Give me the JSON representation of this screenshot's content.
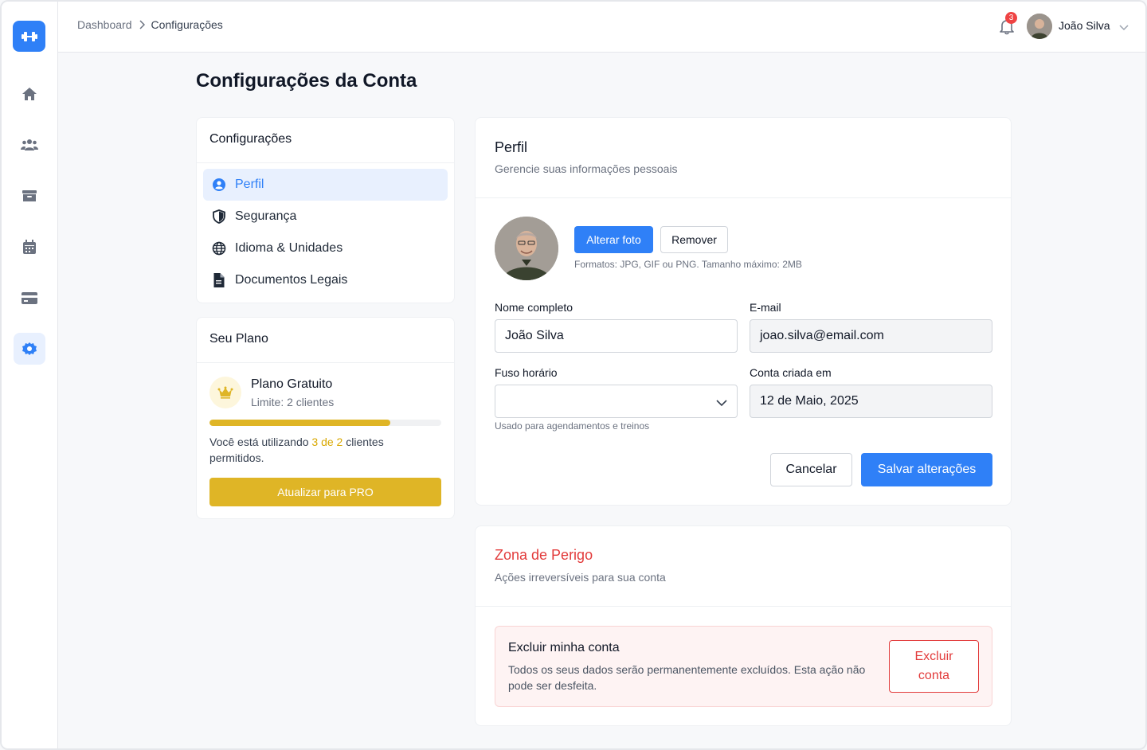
{
  "breadcrumb": {
    "root": "Dashboard",
    "current": "Configurações"
  },
  "header": {
    "notifications_count": "3",
    "user_name": "João Silva"
  },
  "page_title": "Configurações da Conta",
  "settings_menu": {
    "title": "Configurações",
    "items": [
      {
        "label": "Perfil",
        "icon": "user-circle-icon",
        "active": true
      },
      {
        "label": "Segurança",
        "icon": "shield-icon",
        "active": false
      },
      {
        "label": "Idioma & Unidades",
        "icon": "globe-icon",
        "active": false
      },
      {
        "label": "Documentos Legais",
        "icon": "document-icon",
        "active": false
      }
    ]
  },
  "plan": {
    "title": "Seu Plano",
    "name": "Plano Gratuito",
    "limit": "Limite: 2 clientes",
    "usage_prefix": "Você está utilizando",
    "usage_used": "3 de 2",
    "usage_suffix": "clientes permitidos.",
    "usage_fraction": 0.78,
    "upgrade_label": "Atualizar para PRO",
    "accent": "#dfb526"
  },
  "profile": {
    "title": "Perfil",
    "subtitle": "Gerencie suas informações pessoais",
    "change_photo": "Alterar foto",
    "remove_photo": "Remover",
    "photo_hint": "Formatos: JPG, GIF ou PNG. Tamanho máximo: 2MB",
    "fields": {
      "name_label": "Nome completo",
      "name_value": "João Silva",
      "email_label": "E-mail",
      "email_value": "joao.silva@email.com",
      "timezone_label": "Fuso horário",
      "timezone_value": "",
      "timezone_hint": "Usado para agendamentos e treinos",
      "created_label": "Conta criada em",
      "created_value": "12 de Maio, 2025"
    },
    "cancel_label": "Cancelar",
    "save_label": "Salvar alterações"
  },
  "danger": {
    "title": "Zona de Perigo",
    "subtitle": "Ações irreversíveis para sua conta",
    "delete_title": "Excluir minha conta",
    "delete_desc": "Todos os seus dados serão permanentemente excluídos. Esta ação não pode ser desfeita.",
    "delete_button": "Excluir conta"
  },
  "colors": {
    "primary": "#2f80f7",
    "danger": "#e23b3b"
  }
}
